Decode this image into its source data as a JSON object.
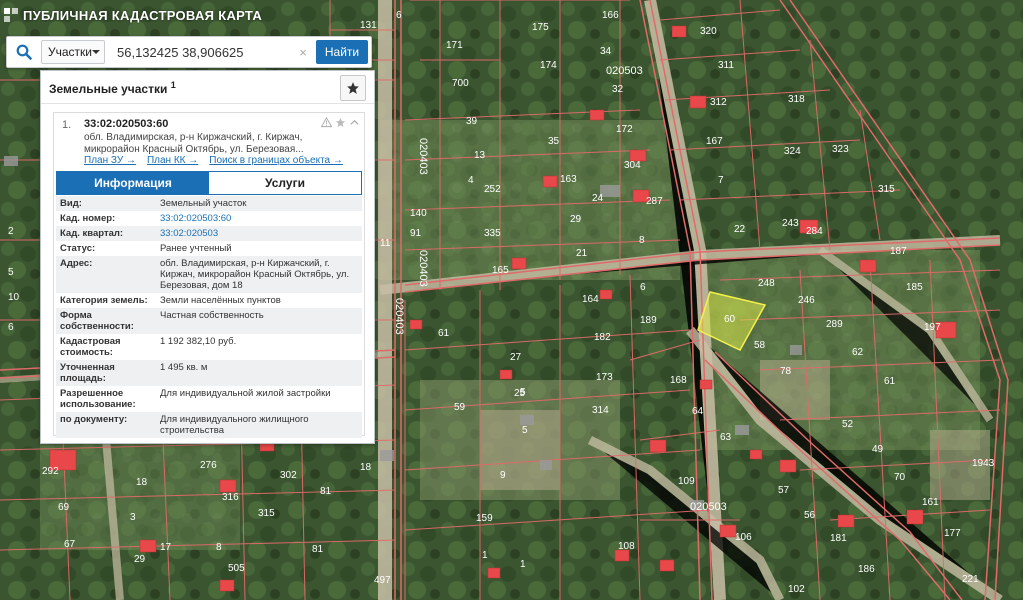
{
  "app": {
    "title": "ПУБЛИЧНАЯ КАДАСТРОВАЯ КАРТА"
  },
  "search": {
    "type_label": "Участки",
    "query": "56,132425 38,906625",
    "find_label": "Найти"
  },
  "panel": {
    "title": "Земельные участки",
    "count": "1"
  },
  "object": {
    "index": "1.",
    "cad_number": "33:02:020503:60",
    "address_short": "обл. Владимирская, р-н Киржачский, г. Киржач, микрорайон Красный Октябрь, ул. Березовая...",
    "links": [
      "План ЗУ →",
      "План КК →",
      "Поиск в границах объекта →"
    ]
  },
  "tabs": [
    "Информация",
    "Услуги"
  ],
  "info": [
    {
      "key": "Вид:",
      "value": "Земельный участок"
    },
    {
      "key": "Кад. номер:",
      "value": "33:02:020503:60",
      "link": true
    },
    {
      "key": "Кад. квартал:",
      "value": "33:02:020503",
      "link": true
    },
    {
      "key": "Статус:",
      "value": "Ранее учтенный"
    },
    {
      "key": "Адрес:",
      "value": "обл. Владимирская, р-н Киржачский, г. Киржач, микрорайон Красный Октябрь, ул. Березовая, дом 18"
    },
    {
      "key": "Категория земель:",
      "value": "Земли населённых пунктов"
    },
    {
      "key": "Форма собственности:",
      "value": "Частная собственность"
    },
    {
      "key": "Кадастровая стоимость:",
      "value": "1 192 382,10 руб."
    },
    {
      "key": "Уточненная площадь:",
      "value": "1 495 кв. м"
    },
    {
      "key": "Разрешенное использование:",
      "value": "Для индивидуальной жилой застройки"
    },
    {
      "key": "по документу:",
      "value": "Для индивидуального жилищного строительства"
    }
  ],
  "map": {
    "colors": {
      "boundary": "#e06a6a",
      "highlight": "#d9e84a",
      "roof": "#e8484a"
    },
    "plot_labels": [
      "131",
      "6",
      "166",
      "171",
      "175",
      "34",
      "320",
      "311",
      "700",
      "174",
      "39",
      "32",
      "312",
      "318",
      "13",
      "4",
      "35",
      "172",
      "167",
      "324",
      "323",
      "252",
      "163",
      "304",
      "7",
      "315",
      "335",
      "29",
      "24",
      "287",
      "22",
      "243",
      "284",
      "187",
      "165",
      "21",
      "8",
      "248",
      "185",
      "164",
      "6",
      "246",
      "197",
      "61",
      "189",
      "289",
      "62",
      "182",
      "168",
      "61",
      "27",
      "173",
      "78",
      "59",
      "25",
      "314",
      "64",
      "52",
      "5",
      "63",
      "49",
      "276",
      "18",
      "292",
      "316",
      "302",
      "81",
      "70",
      "1943",
      "69",
      "315",
      "159",
      "109",
      "161",
      "67",
      "505",
      "81",
      "1",
      "108",
      "106",
      "181",
      "177",
      "497",
      "102",
      "186",
      "221",
      "60",
      "58",
      "57",
      "56",
      "5",
      "18",
      "3",
      "2",
      "10",
      "91",
      "140",
      "11",
      "5",
      "6",
      "29",
      "18",
      "17",
      "8",
      "9",
      "1"
    ],
    "quarter_labels": [
      "020503",
      "020403",
      "020403",
      "020403",
      "020503"
    ]
  }
}
